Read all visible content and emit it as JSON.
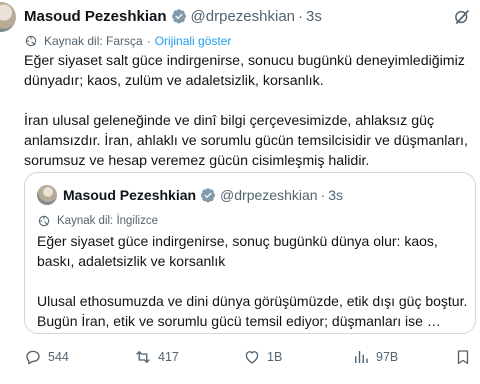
{
  "tweet": {
    "author_name": "Masoud Pezeshkian",
    "handle": "@drpezeshkian",
    "separator": "·",
    "time": "3s",
    "translation": {
      "source_label": "Kaynak dil: Farsça",
      "separator": "·",
      "show_original": "Orijinali göster"
    },
    "text": [
      "Eğer siyaset salt güce indirgenirse, sonucu bugünkü deneyimlediğimiz dünyadır; kaos, zulüm ve adaletsizlik, korsanlık.",
      "İran ulusal geleneğinde ve dinî bilgi çerçevesimizde, ahlaksız güç anlamsızdır. İran, ahlaklı ve sorumlu gücün temsilcisidir ve düşmanları, sorumsuz ve hesap veremez gücün cisimleşmiş halidir."
    ]
  },
  "quote": {
    "author_name": "Masoud Pezeshkian",
    "handle": "@drpezeshkian",
    "separator": "·",
    "time": "3s",
    "source_label": "Kaynak dil: İngilizce",
    "text": [
      "Eğer siyaset güce indirgenirse, sonuç bugünkü dünya olur: kaos, baskı, adaletsizlik ve korsanlık",
      "Ulusal ethosumuzda ve dini dünya görüşümüzde, etik dışı güç boştur. Bugün İran, etik ve sorumlu gücü temsil ediyor; düşmanları ise …"
    ]
  },
  "actions": {
    "replies": "544",
    "reposts": "417",
    "likes": "1B",
    "views": "97B"
  },
  "icons": {
    "verified": "verified-badge-icon",
    "grok": "grok-icon",
    "translate": "translate-icon",
    "reply": "reply-icon",
    "repost": "repost-icon",
    "like": "heart-icon",
    "views": "views-icon",
    "bookmark": "bookmark-icon"
  },
  "colors": {
    "text": "#0f1419",
    "secondary": "#536471",
    "link": "#1d9bf0",
    "border": "#cfd9de"
  }
}
